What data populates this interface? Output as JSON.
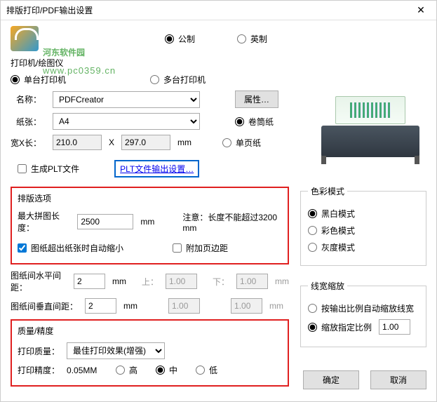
{
  "title": "排版打印/PDF输出设置",
  "watermark": {
    "main": "河东软件园",
    "sub": "www.pc0359.cn"
  },
  "units": {
    "metric": "公制",
    "imperial": "英制",
    "selected": "metric"
  },
  "printer_section": {
    "label": "打印机/绘图仪",
    "single": "单台打印机",
    "multi": "多台打印机",
    "name_label": "名称：",
    "name_value": "PDFCreator",
    "props_btn": "属性…",
    "paper_label": "纸张：",
    "paper_value": "A4",
    "roll": "卷筒纸",
    "sheet": "单页纸",
    "wh_label": "宽X长：",
    "width": "210.0",
    "height": "297.0",
    "mm": "mm",
    "gen_plt": "生成PLT文件",
    "plt_link": "PLT文件输出设置…"
  },
  "layout": {
    "title": "排版选项",
    "max_len_label": "最大拼图长度：",
    "max_len_value": "2500",
    "mm": "mm",
    "note": "注意：长度不能超过3200 mm",
    "autofit": "图纸超出纸张时自动缩小",
    "margin": "附加页边距",
    "hspace_label": "图纸间水平间距：",
    "vspace_label": "图纸间垂直间距：",
    "hspace": "2",
    "vspace": "2",
    "top": "上：",
    "bottom": "下：",
    "topv": "1.00",
    "botv": "1.00",
    "top2": "1.00",
    "bot2": "1.00"
  },
  "color": {
    "title": "色彩模式",
    "bw": "黑白模式",
    "color": "彩色模式",
    "gray": "灰度模式"
  },
  "quality": {
    "title": "质量/精度",
    "q_label": "打印质量：",
    "q_value": "最佳打印效果(增强)",
    "p_label": "打印精度：",
    "p_value": "0.05MM",
    "high": "高",
    "mid": "中",
    "low": "低"
  },
  "linewidth": {
    "title": "线宽缩放",
    "auto": "按输出比例自动缩放线宽",
    "ratio": "缩放指定比例",
    "ratio_value": "1.00"
  },
  "footer": {
    "ok": "确定",
    "cancel": "取消"
  }
}
